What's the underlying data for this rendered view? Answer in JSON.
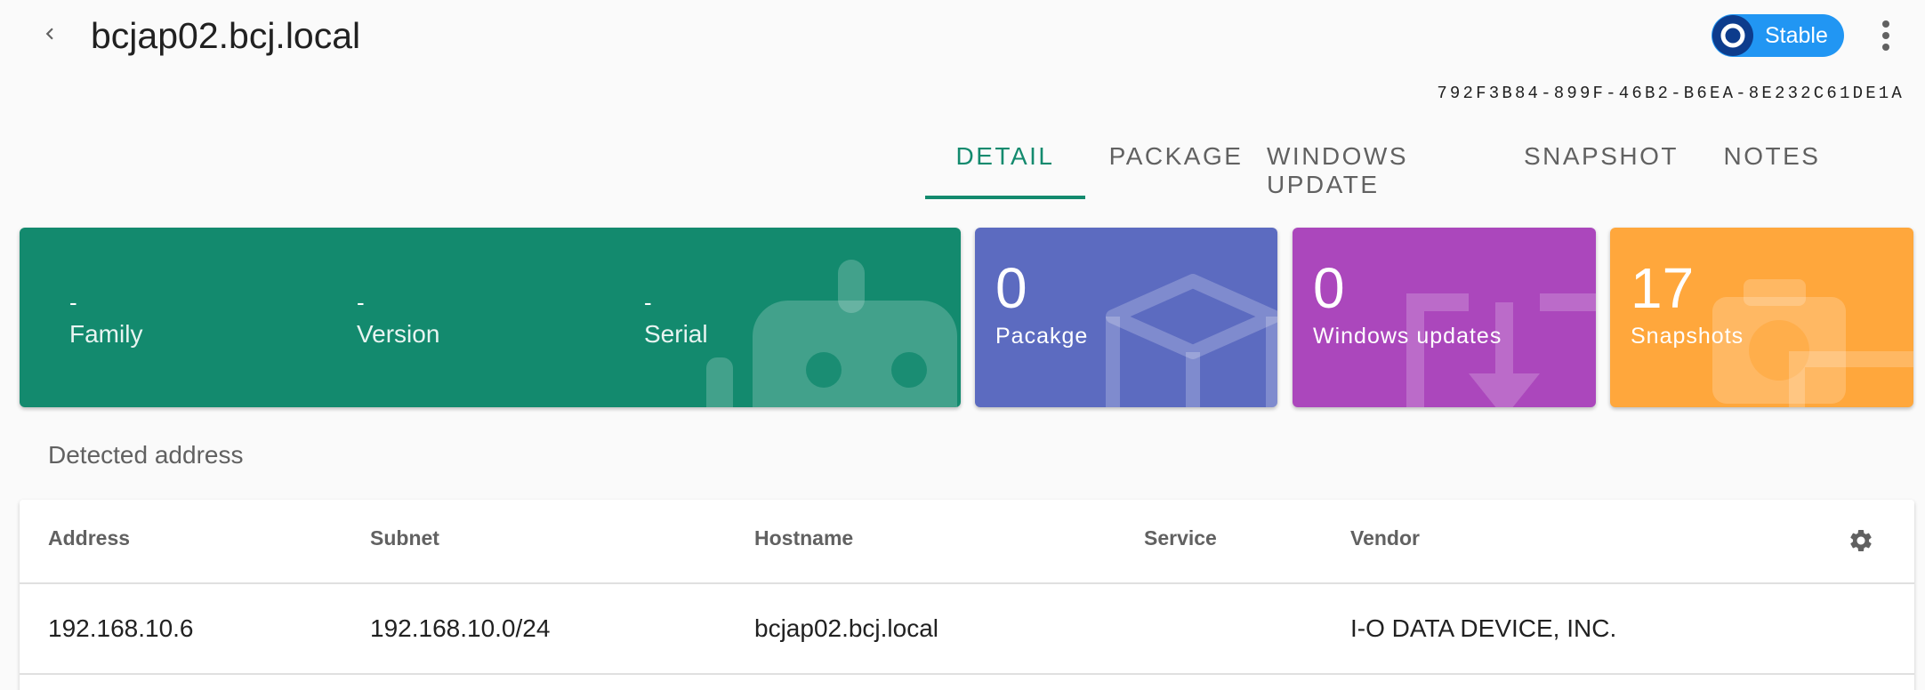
{
  "header": {
    "title": "bcjap02.bcj.local",
    "status_label": "Stable",
    "uuid": "792F3B84-899F-46B2-B6EA-8E232C61DE1A"
  },
  "tabs": [
    {
      "label": "DETAIL",
      "active": true
    },
    {
      "label": "PACKAGE",
      "active": false
    },
    {
      "label": "WINDOWS UPDATE",
      "active": false
    },
    {
      "label": "SNAPSHOT",
      "active": false
    },
    {
      "label": "NOTES",
      "active": false
    }
  ],
  "system_card": {
    "family": {
      "value": "-",
      "label": "Family"
    },
    "version": {
      "value": "-",
      "label": "Version"
    },
    "serial": {
      "value": "-",
      "label": "Serial"
    },
    "icon": "android-robot-icon",
    "color": "#138a6e"
  },
  "stat_cards": [
    {
      "value": "0",
      "label": "Pacakge",
      "icon": "package-box-icon",
      "color": "#5c6bc0"
    },
    {
      "value": "0",
      "label": "Windows updates",
      "icon": "download-update-icon",
      "color": "#ab47bc"
    },
    {
      "value": "17",
      "label": "Snapshots",
      "icon": "camera-snapshot-icon",
      "color": "#ffa73c"
    }
  ],
  "detected_address": {
    "title": "Detected address",
    "columns": [
      "Address",
      "Subnet",
      "Hostname",
      "Service",
      "Vendor"
    ],
    "rows": [
      {
        "address": "192.168.10.6",
        "subnet": "192.168.10.0/24",
        "hostname": "bcjap02.bcj.local",
        "service": "",
        "vendor": "I-O DATA DEVICE, INC."
      }
    ]
  },
  "accent_color": "#138a6e",
  "chip_color": "#2196f3"
}
